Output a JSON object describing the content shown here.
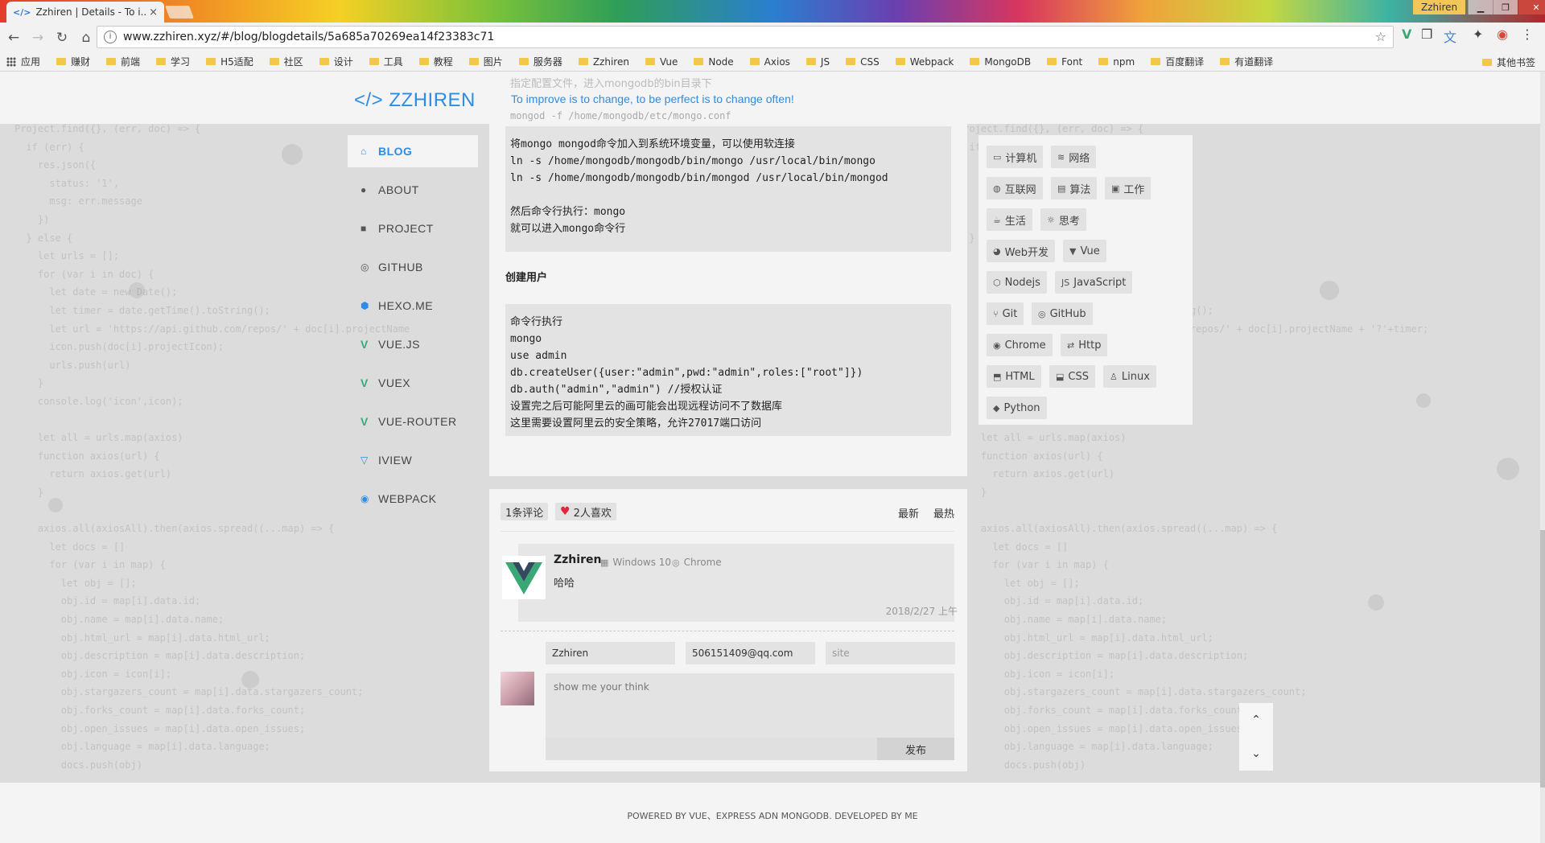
{
  "browser": {
    "tab_title": "Zzhiren | Details - To i...",
    "tab_icon": "</>",
    "close_glyph": "×",
    "window_user": "Zzhiren",
    "url": "www.zzhiren.xyz/#/blog/blogdetails/5a685a70269ea14f23383c71",
    "bookmarks": [
      "应用",
      "赚财",
      "前端",
      "学习",
      "H5适配",
      "社区",
      "设计",
      "工具",
      "教程",
      "图片",
      "服务器",
      "Zzhiren",
      "Vue",
      "Node",
      "Axios",
      "JS",
      "CSS",
      "Webpack",
      "MongoDB",
      "Font",
      "npm",
      "百度翻译",
      "有道翻译"
    ],
    "other_bookmarks": "其他书签"
  },
  "site": {
    "logo": "</> ZZHIREN",
    "slogan": "To improve is to change, to be perfect is to change often!"
  },
  "nav": [
    {
      "label": "BLOG",
      "icon": "home-icon",
      "glyph": "⌂",
      "active": true
    },
    {
      "label": "ABOUT",
      "icon": "user-icon",
      "glyph": "●"
    },
    {
      "label": "PROJECT",
      "icon": "folder-icon",
      "glyph": "■"
    },
    {
      "label": "GITHUB",
      "icon": "github-icon",
      "glyph": "◎"
    },
    {
      "label": "HEXO.ME",
      "icon": "hexo-icon",
      "glyph": "⬢"
    },
    {
      "label": "VUE.JS",
      "icon": "vue-icon",
      "glyph": "V"
    },
    {
      "label": "VUEX",
      "icon": "vue-icon",
      "glyph": "V"
    },
    {
      "label": "VUE-ROUTER",
      "icon": "vue-icon",
      "glyph": "V"
    },
    {
      "label": "IVIEW",
      "icon": "iview-icon",
      "glyph": "▽"
    },
    {
      "label": "WEBPACK",
      "icon": "webpack-icon",
      "glyph": "◉"
    }
  ],
  "article": {
    "faded_line": "指定配置文件，进入mongodb的bin目录下",
    "faded_code": "mongod -f /home/mongodb/etc/mongo.conf",
    "block1": [
      "将mongo mongod命令加入到系统环境变量，可以使用软连接",
      "ln -s /home/mongodb/mongodb/bin/mongo /usr/local/bin/mongo",
      "ln -s /home/mongodb/mongodb/bin/mongod /usr/local/bin/mongod",
      "",
      "然后命令行执行：mongo",
      "就可以进入mongo命令行"
    ],
    "subheading": "创建用户",
    "block2": [
      "命令行执行",
      "mongo",
      "use admin",
      "db.createUser({user:\"admin\",pwd:\"admin\",roles:[\"root\"]})",
      "db.auth(\"admin\",\"admin\") //授权认证",
      "设置完之后可能阿里云的画可能会出现远程访问不了数据库",
      "这里需要设置阿里云的安全策略，允许27017端口访问"
    ]
  },
  "tags": [
    {
      "label": "计算机",
      "icon": "monitor-icon",
      "glyph": "▭"
    },
    {
      "label": "网络",
      "icon": "network-icon",
      "glyph": "≋"
    },
    {
      "label": "互联网",
      "icon": "internet-icon",
      "glyph": "◍"
    },
    {
      "label": "算法",
      "icon": "algorithm-icon",
      "glyph": "▤"
    },
    {
      "label": "工作",
      "icon": "briefcase-icon",
      "glyph": "▣"
    },
    {
      "label": "生活",
      "icon": "coffee-icon",
      "glyph": "☕"
    },
    {
      "label": "思考",
      "icon": "bulb-icon",
      "glyph": "☼"
    },
    {
      "label": "Web开发",
      "icon": "web-icon",
      "glyph": "◕"
    },
    {
      "label": "Vue",
      "icon": "vue-icon",
      "glyph": "▼"
    },
    {
      "label": "Nodejs",
      "icon": "nodejs-icon",
      "glyph": "⬡"
    },
    {
      "label": "JavaScript",
      "icon": "js-icon",
      "glyph": "JS"
    },
    {
      "label": "Git",
      "icon": "git-icon",
      "glyph": "⑂"
    },
    {
      "label": "GitHub",
      "icon": "github-icon",
      "glyph": "◎"
    },
    {
      "label": "Chrome",
      "icon": "chrome-icon",
      "glyph": "◉"
    },
    {
      "label": "Http",
      "icon": "http-icon",
      "glyph": "⇄"
    },
    {
      "label": "HTML",
      "icon": "html5-icon",
      "glyph": "⬒"
    },
    {
      "label": "CSS",
      "icon": "css3-icon",
      "glyph": "⬓"
    },
    {
      "label": "Linux",
      "icon": "linux-icon",
      "glyph": "♙"
    },
    {
      "label": "Python",
      "icon": "python-icon",
      "glyph": "◆"
    }
  ],
  "comments": {
    "count_label": "1条评论",
    "likes_label": "2人喜欢",
    "sort_latest": "最新",
    "sort_hottest": "最热",
    "items": [
      {
        "name": "Zzhiren",
        "os": "Windows 10",
        "browser": "Chrome",
        "text": "哈哈",
        "date": "2018/2/27 上午"
      }
    ],
    "form": {
      "name_value": "Zzhiren",
      "email_value": "506151409@qq.com",
      "site_placeholder": "site",
      "content_placeholder": "show me your think",
      "submit_label": "发布"
    }
  },
  "footer": "POWERED BY VUE、EXPRESS ADN MONGODB. DEVELOPED BY ME",
  "scroll": {
    "up": "⌃",
    "down": "⌄"
  },
  "colors": {
    "accent": "#2d8ce6",
    "vue": "#3aa876",
    "heart": "#e2273c"
  }
}
